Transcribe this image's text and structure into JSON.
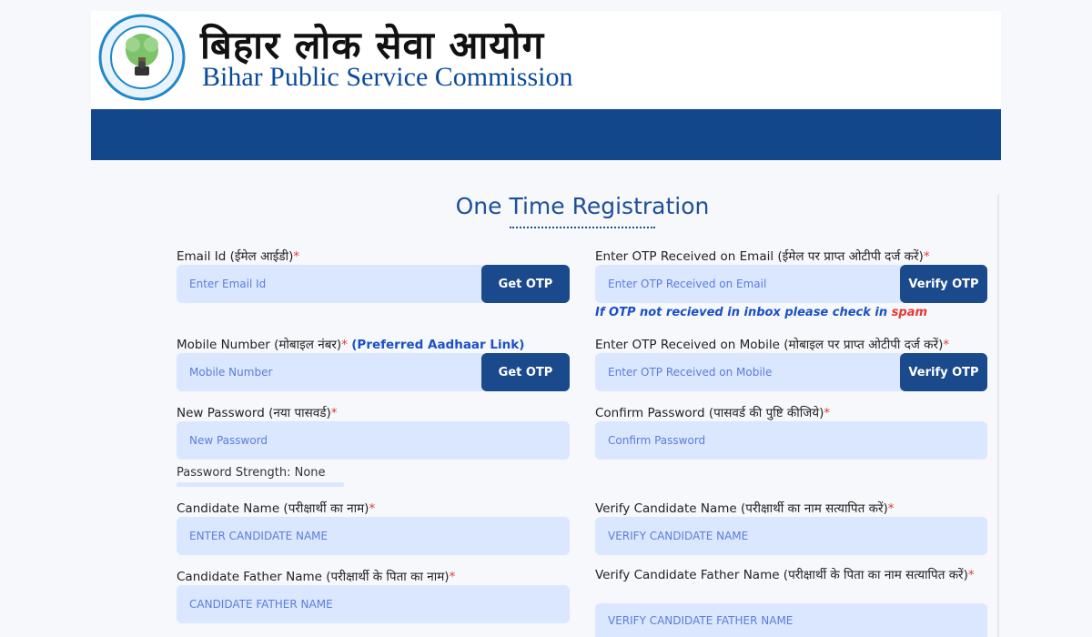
{
  "header": {
    "logo_hindi": "बिहार लोक सेवा आयोग",
    "logo_english": "Bihar Public Service Commission",
    "navbar_color": "#12478c"
  },
  "form": {
    "title": "One Time Registration",
    "email": {
      "label": "Email Id (ईमेल आईडी)",
      "required": "*",
      "placeholder": "Enter Email Id",
      "button": "Get OTP"
    },
    "email_otp": {
      "label": "Enter OTP Received on Email (ईमेल पर प्राप्त ओटीपी दर्ज करें)",
      "required": "*",
      "placeholder": "Enter OTP Received on Email",
      "button": "Verify OTP"
    },
    "spam_note": {
      "text": "If OTP not recieved in inbox please check in",
      "spam": "spam"
    },
    "mobile": {
      "label": "Mobile Number (मोबाइल नंबर)",
      "required": "*",
      "link": "(Preferred Aadhaar Link)",
      "placeholder": "Mobile Number",
      "button": "Get OTP"
    },
    "mobile_otp": {
      "label": "Enter OTP Received on Mobile (मोबाइल पर प्राप्त ओटीपी दर्ज करें)",
      "required": "*",
      "placeholder": "Enter OTP Received on Mobile",
      "button": "Verify OTP"
    },
    "new_password": {
      "label": "New Password (नया पासवर्ड)",
      "required": "*",
      "placeholder": "New Password"
    },
    "confirm_password": {
      "label": "Confirm Password (पासवर्ड की पुष्टि कीजिये)",
      "required": "*",
      "placeholder": "Confirm Password"
    },
    "password_strength": "Password Strength: None",
    "candidate_name": {
      "label": "Candidate Name (परीक्षार्थी का नाम)",
      "required": "*",
      "placeholder": "ENTER CANDIDATE NAME"
    },
    "verify_candidate_name": {
      "label": "Verify Candidate Name (परीक्षार्थी का नाम सत्यापित करें)",
      "required": "*",
      "placeholder": "VERIFY CANDIDATE NAME"
    },
    "father_name": {
      "label": "Candidate Father Name (परीक्षार्थी के पिता का नाम)",
      "required": "*",
      "placeholder": "CANDIDATE FATHER NAME"
    },
    "verify_father_name": {
      "label": "Verify Candidate Father Name (परीक्षार्थी के पिता का नाम सत्यापित करें)",
      "required": "*",
      "placeholder": "VERIFY CANDIDATE FATHER NAME"
    }
  }
}
